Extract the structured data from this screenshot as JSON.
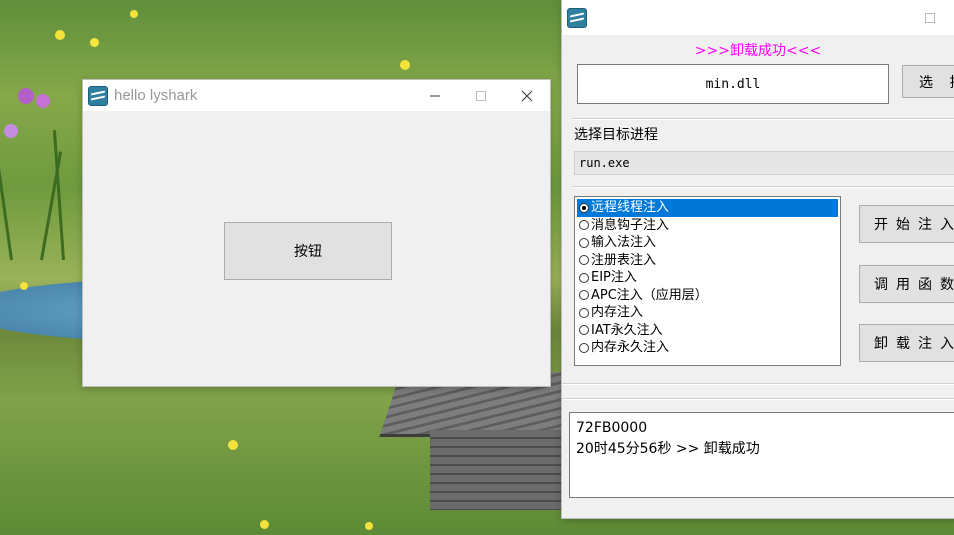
{
  "window_main": {
    "title": "hello lyshark",
    "button_label": "按钮"
  },
  "window_injector": {
    "status_text": ">>>卸载成功<<<",
    "dll_value": "min.dll",
    "select_button": "选 择",
    "process_label": "选择目标进程",
    "process_value": "run.exe",
    "injection_methods": [
      "远程线程注入",
      "消息钩子注入",
      "输入法注入",
      "注册表注入",
      "EIP注入",
      "APC注入（应用层）",
      "内存注入",
      "IAT永久注入",
      "内存永久注入"
    ],
    "selected_method_index": 0,
    "buttons": {
      "start_inject": "开始注入",
      "call_function": "调用函数",
      "unload_inject": "卸载注入"
    },
    "log_lines": [
      "72FB0000",
      "20时45分56秒 >> 卸载成功"
    ]
  },
  "colors": {
    "status_magenta": "#ff00ff",
    "selection_blue": "#0078d7"
  },
  "icons": [
    "app-icon",
    "minimize-icon",
    "maximize-icon",
    "close-icon"
  ]
}
